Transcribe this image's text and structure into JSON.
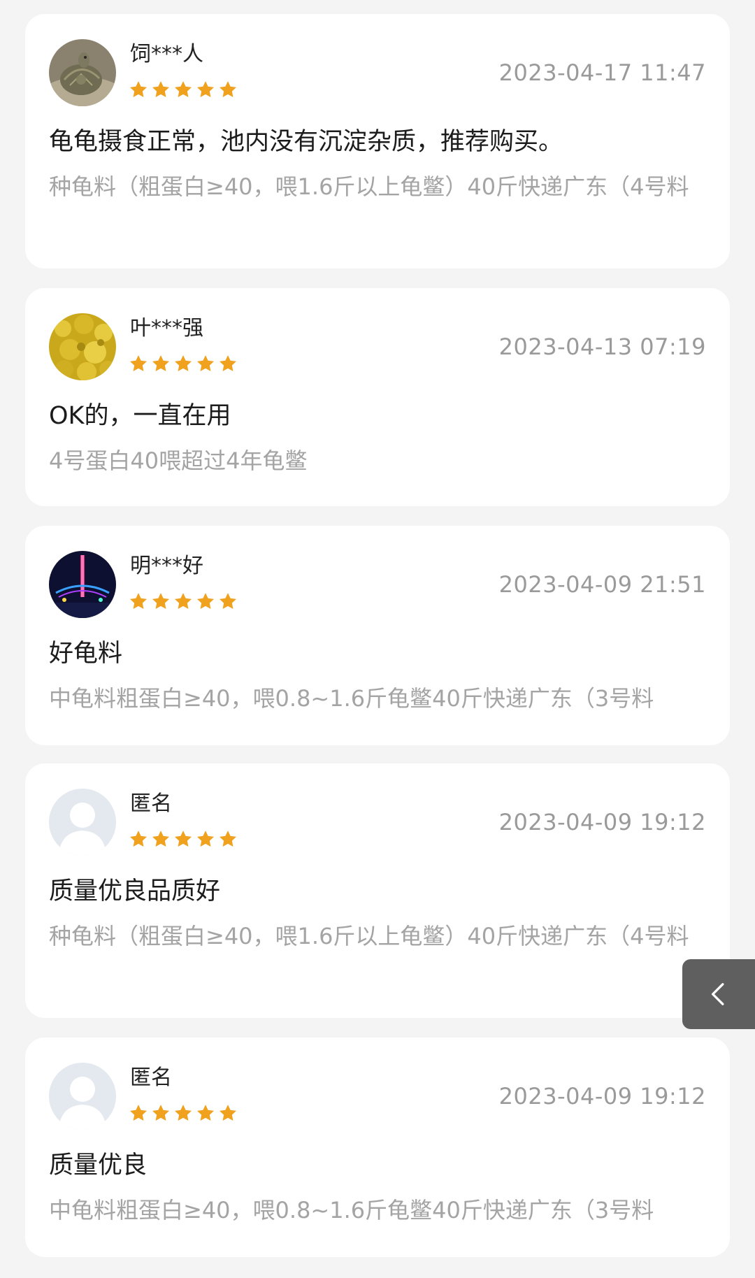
{
  "accent": {
    "star": "#f0a21f",
    "back_button_bg": "#5f5f5f"
  },
  "reviews": [
    {
      "user": "饲***人",
      "avatar_icon": "turtle-avatar",
      "rating": 5,
      "datetime": "2023-04-17 11:47",
      "comment": "龟龟摄食正常，池内没有沉淀杂质，推荐购买。",
      "spec": "种龟料（粗蛋白≥40，喂1.6斤以上龟鳖）40斤快递广东（4号料"
    },
    {
      "user": "叶***强",
      "avatar_icon": "yellow-flowers-avatar",
      "rating": 5,
      "datetime": "2023-04-13 07:19",
      "comment": "OK的，一直在用",
      "spec": "4号蛋白40喂超过4年龟鳖"
    },
    {
      "user": "明***好",
      "avatar_icon": "night-tower-avatar",
      "rating": 5,
      "datetime": "2023-04-09 21:51",
      "comment": "好龟料",
      "spec": "中龟料粗蛋白≥40，喂0.8~1.6斤龟鳖40斤快递广东（3号料"
    },
    {
      "user": "匿名",
      "avatar_icon": "default-user-avatar",
      "rating": 5,
      "datetime": "2023-04-09 19:12",
      "comment": "质量优良品质好",
      "spec": "种龟料（粗蛋白≥40，喂1.6斤以上龟鳖）40斤快递广东（4号料"
    },
    {
      "user": "匿名",
      "avatar_icon": "default-user-avatar",
      "rating": 5,
      "datetime": "2023-04-09 19:12",
      "comment": "质量优良",
      "spec": "中龟料粗蛋白≥40，喂0.8~1.6斤龟鳖40斤快递广东（3号料"
    }
  ],
  "back_button": {
    "icon": "chevron-left-icon"
  }
}
